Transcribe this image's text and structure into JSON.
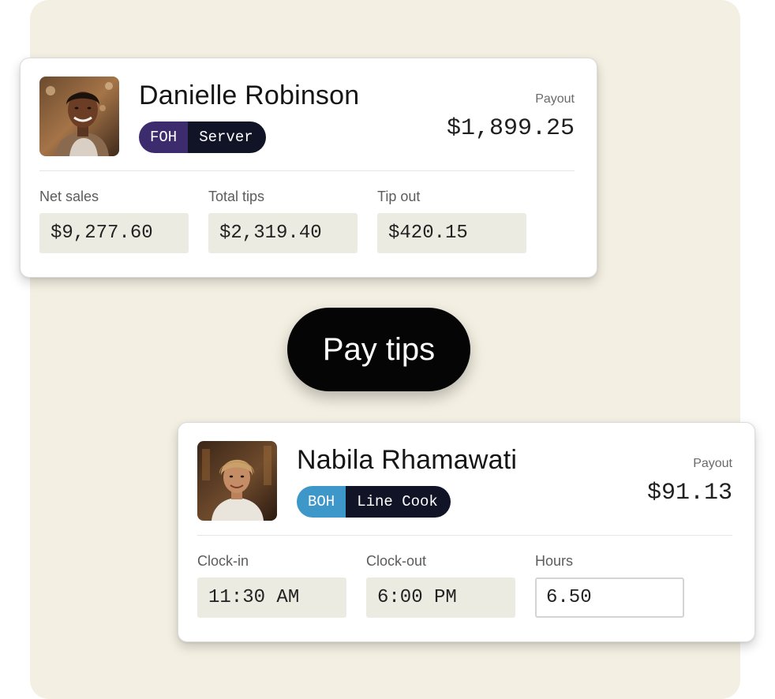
{
  "cards": [
    {
      "name": "Danielle Robinson",
      "department": "FOH",
      "role": "Server",
      "payout_label": "Payout",
      "payout_value": "$1,899.25",
      "fields": [
        {
          "label": "Net sales",
          "value": "$9,277.60"
        },
        {
          "label": "Total tips",
          "value": "$2,319.40"
        },
        {
          "label": "Tip out",
          "value": "$420.15"
        }
      ]
    },
    {
      "name": "Nabila Rhamawati",
      "department": "BOH",
      "role": "Line Cook",
      "payout_label": "Payout",
      "payout_value": "$91.13",
      "fields": [
        {
          "label": "Clock-in",
          "value": "11:30 AM"
        },
        {
          "label": "Clock-out",
          "value": "6:00 PM"
        },
        {
          "label": "Hours",
          "value": "6.50"
        }
      ]
    }
  ],
  "action": {
    "label": "Pay tips"
  },
  "colors": {
    "backdrop": "#f3efe2",
    "foh_badge": "#3c2c6e",
    "boh_badge": "#3d97c9",
    "role_badge": "#111327",
    "button": "#050505"
  }
}
